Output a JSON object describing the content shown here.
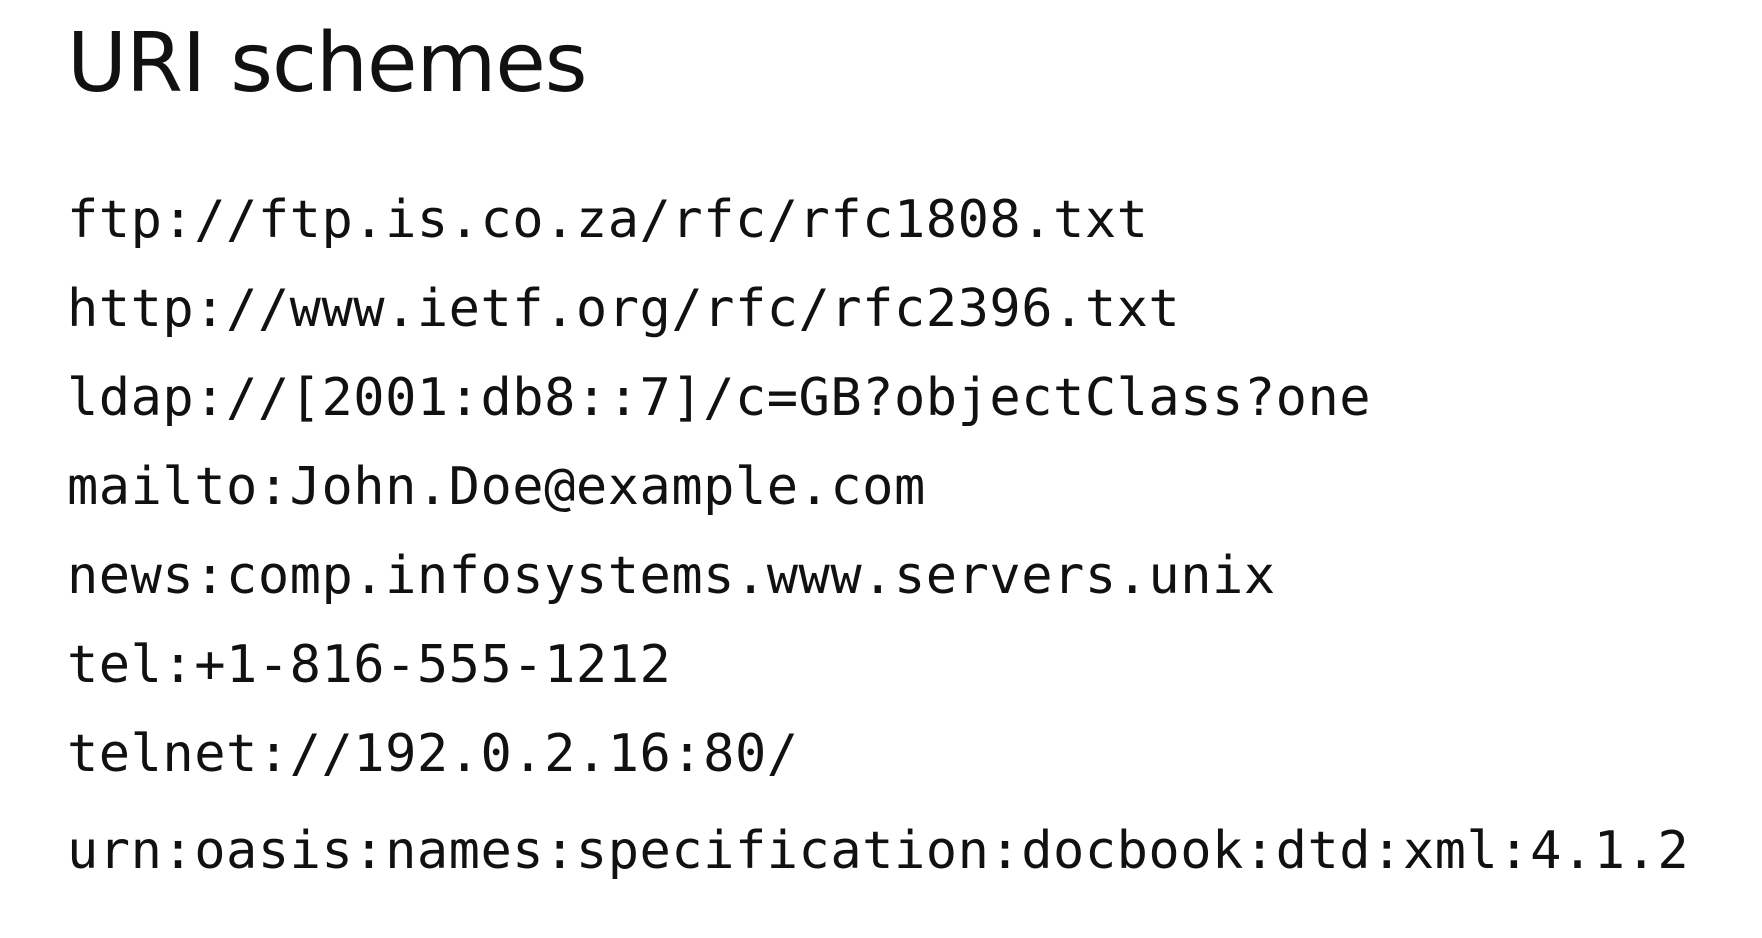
{
  "slide": {
    "title": "URI schemes",
    "uris": [
      "ftp://ftp.is.co.za/rfc/rfc1808.txt",
      "http://www.ietf.org/rfc/rfc2396.txt",
      "ldap://[2001:db8::7]/c=GB?objectClass?one",
      "mailto:John.Doe@example.com",
      "news:comp.infosystems.www.servers.unix",
      "tel:+1-816-555-1212",
      "telnet://192.0.2.16:80/",
      "urn:oasis:names:specification:docbook:dtd:xml:4.1.2"
    ]
  }
}
